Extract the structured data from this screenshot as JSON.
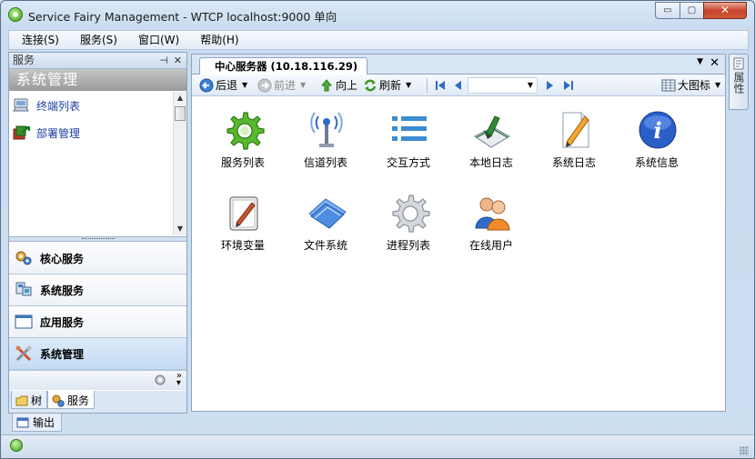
{
  "window": {
    "title": "Service Fairy Management - WTCP localhost:9000 单向",
    "controls": {
      "minimize": "▭",
      "maximize": "▢",
      "close": "✕"
    }
  },
  "menubar": {
    "items": [
      "连接(S)",
      "服务(S)",
      "窗口(W)",
      "帮助(H)"
    ]
  },
  "left_panel": {
    "header": "服务",
    "pin": "⊣",
    "close": "✕",
    "banner": "系统管理",
    "tree_items": [
      {
        "label": "终端列表",
        "icon": "terminal-list-icon"
      },
      {
        "label": "部署管理",
        "icon": "deploy-icon"
      }
    ],
    "nav_buttons": [
      {
        "label": "核心服务",
        "icon": "core-service-icon"
      },
      {
        "label": "系统服务",
        "icon": "system-service-icon"
      },
      {
        "label": "应用服务",
        "icon": "app-service-icon"
      },
      {
        "label": "系统管理",
        "icon": "system-manage-icon",
        "active": true
      }
    ],
    "bottom_tabs": [
      {
        "label": "树",
        "icon": "tree-icon"
      },
      {
        "label": "服务",
        "icon": "service-icon",
        "active": true
      }
    ]
  },
  "document": {
    "tab_title": "中心服务器 (10.18.116.29)",
    "toolbar": {
      "back": "后退",
      "forward": "前进",
      "up": "向上",
      "refresh": "刷新",
      "view": "大图标",
      "address_value": ""
    },
    "tiles": [
      {
        "label": "服务列表",
        "icon": "gear-green-icon"
      },
      {
        "label": "信道列表",
        "icon": "channel-icon"
      },
      {
        "label": "交互方式",
        "icon": "list-icon"
      },
      {
        "label": "本地日志",
        "icon": "local-log-icon"
      },
      {
        "label": "系统日志",
        "icon": "system-log-icon"
      },
      {
        "label": "系统信息",
        "icon": "info-icon"
      },
      {
        "label": "环境变量",
        "icon": "env-var-icon"
      },
      {
        "label": "文件系统",
        "icon": "file-system-icon"
      },
      {
        "label": "进程列表",
        "icon": "process-gear-icon"
      },
      {
        "label": "在线用户",
        "icon": "online-users-icon"
      }
    ]
  },
  "right_strip": {
    "label": "属性"
  },
  "output_tab": {
    "label": "输出"
  },
  "colors": {
    "chrome": "#cfe0f2",
    "accent_blue": "#2f6cc8",
    "green": "#49a52a",
    "close_red": "#c8442b"
  }
}
